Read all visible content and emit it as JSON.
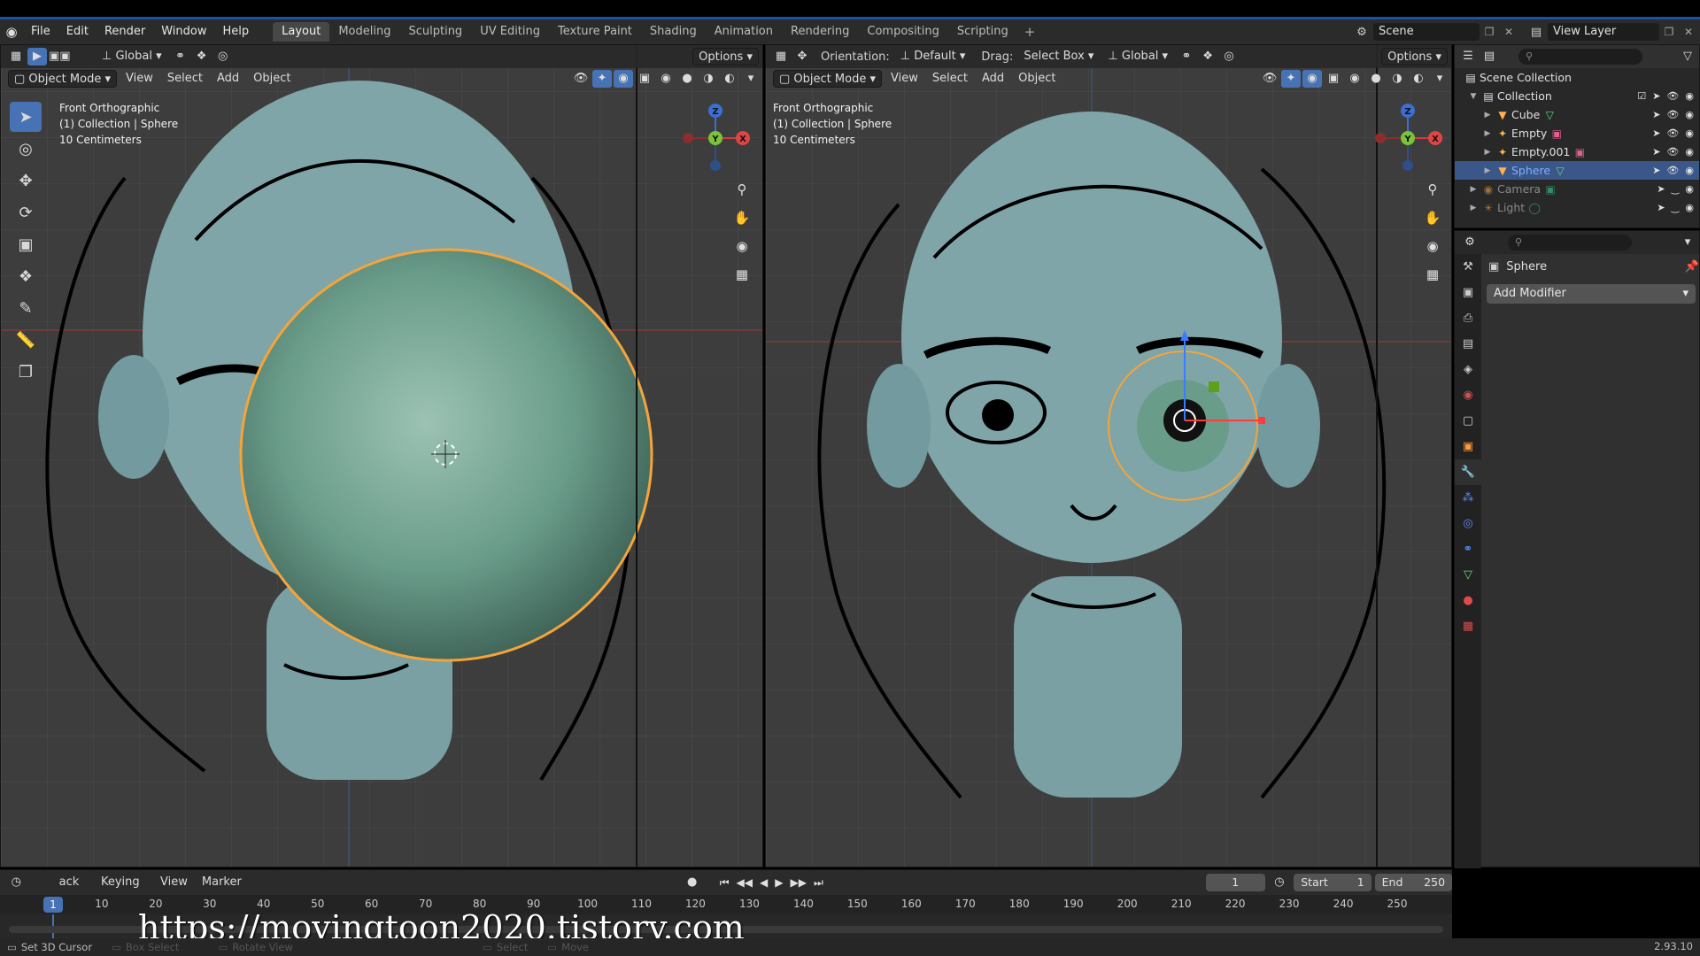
{
  "menubar": {
    "items": [
      "File",
      "Edit",
      "Render",
      "Window",
      "Help"
    ],
    "workspaces": [
      "Layout",
      "Modeling",
      "Sculpting",
      "UV Editing",
      "Texture Paint",
      "Shading",
      "Animation",
      "Rendering",
      "Compositing",
      "Scripting"
    ],
    "active_workspace": "Layout",
    "scene": "Scene",
    "view_layer": "View Layer"
  },
  "left_viewport": {
    "orientation": "Global",
    "options": "Options",
    "mode": "Object Mode",
    "menus": [
      "View",
      "Select",
      "Add",
      "Object"
    ],
    "view_name": "Front Orthographic",
    "collection": "(1) Collection | Sphere",
    "scale": "10 Centimeters"
  },
  "right_viewport": {
    "orientation_label": "Orientation:",
    "orientation_value": "Default",
    "drag_label": "Drag:",
    "drag_value": "Select Box",
    "transform_space": "Global",
    "options": "Options",
    "mode": "Object Mode",
    "menus": [
      "View",
      "Select",
      "Add",
      "Object"
    ],
    "view_name": "Front Orthographic",
    "collection": "(1) Collection | Sphere",
    "scale": "10 Centimeters"
  },
  "frame_overlay": "8",
  "outliner": {
    "scene_collection": "Scene Collection",
    "collection": "Collection",
    "items": [
      {
        "name": "Cube",
        "color": "#ffb14a"
      },
      {
        "name": "Empty",
        "color": "#ffb14a"
      },
      {
        "name": "Empty.001",
        "color": "#ffb14a"
      },
      {
        "name": "Sphere",
        "color": "#ffb14a"
      }
    ],
    "dim_items": [
      {
        "name": "Camera"
      },
      {
        "name": "Light"
      }
    ]
  },
  "properties": {
    "object_name": "Sphere",
    "add_modifier": "Add Modifier"
  },
  "timeline": {
    "menus": [
      "Playback",
      "Keying",
      "View",
      "Marker"
    ],
    "playback_visible": "ack",
    "current_frame": "1",
    "start_label": "Start",
    "start_value": "1",
    "end_label": "End",
    "end_value": "250",
    "ticks": [
      "10",
      "20",
      "30",
      "40",
      "50",
      "60",
      "70",
      "80",
      "90",
      "100",
      "110",
      "120",
      "130",
      "140",
      "150",
      "160",
      "170",
      "180",
      "190",
      "200",
      "210",
      "220",
      "230",
      "240",
      "250"
    ]
  },
  "watermark": "https://movingtoon2020.tistory.com",
  "statusbar": {
    "set_cursor": "Set 3D Cursor",
    "box_select": "Box Select",
    "rotate_view": "Rotate View",
    "select": "Select",
    "move": "Move",
    "version": "2.93.10"
  },
  "colors": {
    "accent": "#4772b3",
    "selection_outline": "#f5a43a",
    "head_skin": "#7fa5a8",
    "sphere": "#6a9c8a",
    "frame_overlay": "#f3f32a"
  }
}
